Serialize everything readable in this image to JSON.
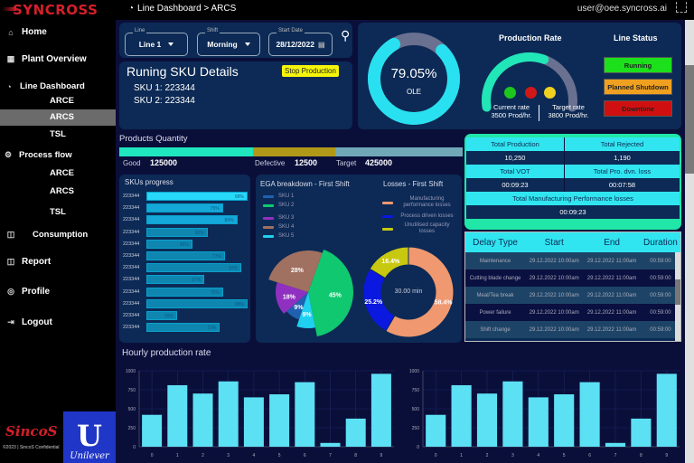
{
  "sidebar": {
    "brand": "SYNCROSS",
    "items": [
      {
        "label": "Home",
        "icon": "home-icon"
      },
      {
        "label": "Plant Overview",
        "icon": "grid-icon"
      },
      {
        "label": "Line Dashboard",
        "icon": "gauge-icon",
        "children": [
          "ARCE",
          "ARCS",
          "TSL"
        ],
        "active_child": "ARCS"
      },
      {
        "label": "Process flow",
        "icon": "gears-icon",
        "children": [
          "ARCE",
          "ARCS",
          "TSL"
        ]
      },
      {
        "label": "Consumption",
        "icon": "chart-icon"
      },
      {
        "label": "Report",
        "icon": "report-icon"
      },
      {
        "label": "Profile",
        "icon": "profile-icon"
      },
      {
        "label": "Logout",
        "icon": "logout-icon"
      }
    ],
    "footer_logo": "SincoS",
    "copyright": "©2023 | SincoS Confidential",
    "partner_logo": "Unilever"
  },
  "topbar": {
    "breadcrumb": "Line Dashboard > ARCS",
    "user": "user@oee.syncross.ai"
  },
  "filters": {
    "line": {
      "label": "Line",
      "value": "Line 1"
    },
    "shift": {
      "label": "Shift",
      "value": "Morning"
    },
    "date": {
      "label": "Start Date",
      "value": "28/12/2022"
    }
  },
  "sku_details": {
    "title": "Runing SKU Details",
    "stop_label": "Stop Production",
    "skus": [
      "SKU 1: 223344",
      "SKU 2: 223344"
    ]
  },
  "ole": {
    "value": "79.05%",
    "label": "OLE",
    "fraction": 0.7905
  },
  "production_rate": {
    "title": "Production Rate",
    "current_label": "Current rate",
    "current_value": "3500 Prod/hr.",
    "target_label": "Target rate",
    "target_value": "3800 Prod/hr.",
    "fraction": 0.6,
    "dots": [
      "#1ec71e",
      "#d01818",
      "#f0d020"
    ]
  },
  "line_status": {
    "title": "Line Status",
    "buttons": [
      {
        "label": "Running",
        "color": "#1be01b"
      },
      {
        "label": "Planned Shutdown",
        "color": "#f0a020"
      },
      {
        "label": "Downtime",
        "color": "#d01010"
      }
    ]
  },
  "products_quantity": {
    "title": "Products Quantity",
    "good_label": "Good",
    "good": "125000",
    "defective_label": "Defective",
    "defective": "12500",
    "target_label": "Target",
    "target": "425000",
    "segments": [
      0.39,
      0.24,
      0.37
    ]
  },
  "kpis": {
    "total_production_label": "Total Production",
    "total_production": "10,250",
    "total_rejected_label": "Total Rejected",
    "total_rejected": "1,190",
    "total_vot_label": "Total VOT",
    "total_vot": "00:09:23",
    "total_pro_dvn_loss_label": "Total Pro. dvn. loss",
    "total_pro_dvn_loss": "00:07:58",
    "total_mfg_label": "Total Manufacturing Performance losses",
    "total_mfg": "00:09:23"
  },
  "delay_table": {
    "headers": [
      "Delay Type",
      "Start",
      "End",
      "Duration"
    ],
    "rows": [
      [
        "Maintenance",
        "29.12.2022 10:00am",
        "29.12.2022 11:00am",
        "00:59:00"
      ],
      [
        "Cutting blade change",
        "29.12.2022 10:00am",
        "29.12.2022 11:00am",
        "00:59:00"
      ],
      [
        "Meal/Tea break",
        "29.12.2022 10:00am",
        "29.12.2022 11:00am",
        "00:59:00"
      ],
      [
        "Power failure",
        "29.12.2022 10:00am",
        "29.12.2022 11:00am",
        "00:59:00"
      ],
      [
        "Shift change",
        "29.12.2022 10:00am",
        "29.12.2022 11:00am",
        "00:59:00"
      ]
    ]
  },
  "sku_progress": {
    "title": "SKUs progress",
    "items": [
      {
        "name": "223344",
        "pct": 99
      },
      {
        "name": "223344",
        "pct": 75
      },
      {
        "name": "223344",
        "pct": 89
      },
      {
        "name": "223344",
        "pct": 60
      },
      {
        "name": "223344",
        "pct": 45
      },
      {
        "name": "223344",
        "pct": 77
      },
      {
        "name": "223344",
        "pct": 93
      },
      {
        "name": "223344",
        "pct": 57
      },
      {
        "name": "223344",
        "pct": 75
      },
      {
        "name": "223344",
        "pct": 99
      },
      {
        "name": "223344",
        "pct": 30
      },
      {
        "name": "223344",
        "pct": 72
      }
    ]
  },
  "chart_data": [
    {
      "type": "pie",
      "title": "EGA breakdown - First Shift",
      "labels": [
        "SKU 1",
        "SKU 2",
        "SKU 3",
        "SKU 4",
        "SKU 5"
      ],
      "values": [
        9,
        45,
        18,
        28,
        9
      ],
      "colors": [
        "#2060b0",
        "#10c870",
        "#9030c0",
        "#a07060",
        "#20d0f0"
      ],
      "legend": "top-left"
    },
    {
      "type": "pie",
      "title": "Losses - First Shift",
      "center_label": "30.00 min",
      "labels": [
        "Manufacturing performance losses",
        "Process driven losses",
        "Unutilised capacity losses"
      ],
      "values": [
        58.4,
        25.2,
        16.4
      ],
      "colors": [
        "#f09870",
        "#0a18e0",
        "#c8c810"
      ],
      "legend": "top-right"
    },
    {
      "type": "bar",
      "title": "Hourly production rate",
      "categories": [
        "0",
        "1",
        "2",
        "3",
        "4",
        "5",
        "6",
        "7",
        "8",
        "9"
      ],
      "values": [
        420,
        810,
        700,
        860,
        650,
        690,
        850,
        50,
        370,
        960
      ],
      "ylim": [
        0,
        1000
      ],
      "yticks": [
        0,
        250,
        500,
        750,
        1000
      ],
      "grid": true
    },
    {
      "type": "bar",
      "title": "",
      "categories": [
        "0",
        "1",
        "2",
        "3",
        "4",
        "5",
        "6",
        "7",
        "8",
        "9"
      ],
      "values": [
        420,
        810,
        700,
        860,
        650,
        690,
        850,
        50,
        370,
        960
      ],
      "ylim": [
        0,
        1000
      ],
      "yticks": [
        0,
        250,
        500,
        750,
        1000
      ],
      "grid": true
    }
  ]
}
